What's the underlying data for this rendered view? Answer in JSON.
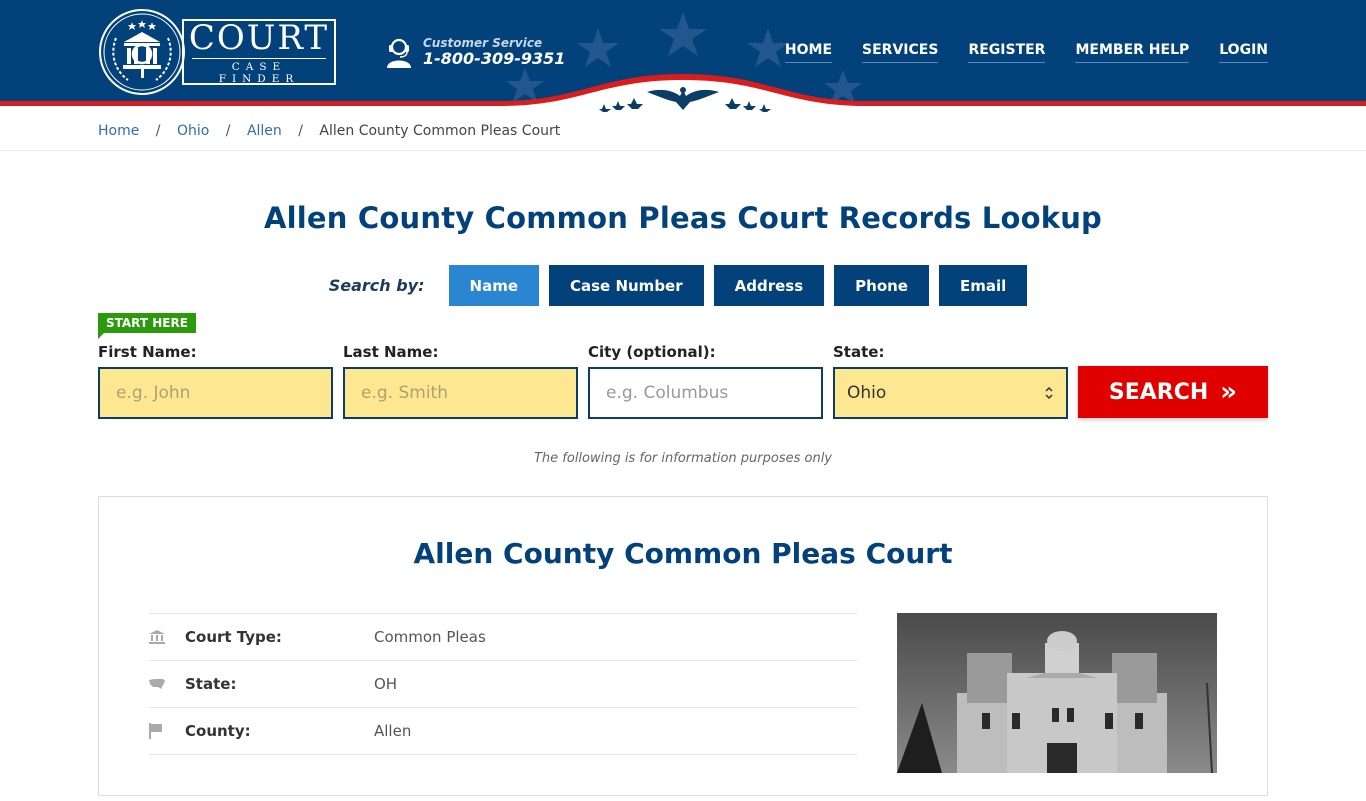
{
  "header": {
    "logo": {
      "title": "COURT",
      "subtitle": "CASE FINDER"
    },
    "customer_service": {
      "label": "Customer Service",
      "phone": "1-800-309-9351"
    },
    "nav": [
      {
        "label": "HOME"
      },
      {
        "label": "SERVICES"
      },
      {
        "label": "REGISTER"
      },
      {
        "label": "MEMBER HELP"
      },
      {
        "label": "LOGIN"
      }
    ]
  },
  "breadcrumb": {
    "items": [
      {
        "label": "Home"
      },
      {
        "label": "Ohio"
      },
      {
        "label": "Allen"
      }
    ],
    "current": "Allen County Common Pleas Court",
    "separator": "/"
  },
  "main": {
    "title": "Allen County Common Pleas Court Records Lookup",
    "search_by": {
      "label": "Search by:",
      "tabs": [
        {
          "label": "Name",
          "active": true
        },
        {
          "label": "Case Number",
          "active": false
        },
        {
          "label": "Address",
          "active": false
        },
        {
          "label": "Phone",
          "active": false
        },
        {
          "label": "Email",
          "active": false
        }
      ]
    },
    "form": {
      "badge": "START HERE",
      "first_name": {
        "label": "First Name:",
        "placeholder": "e.g. John",
        "value": ""
      },
      "last_name": {
        "label": "Last Name:",
        "placeholder": "e.g. Smith",
        "value": ""
      },
      "city": {
        "label": "City (optional):",
        "placeholder": "e.g.  Columbus",
        "value": ""
      },
      "state": {
        "label": "State:",
        "value": "Ohio"
      },
      "search_button": "SEARCH",
      "search_arrow": "»"
    },
    "disclaimer": "The following is for information purposes only"
  },
  "court": {
    "title": "Allen County Common Pleas Court",
    "details": [
      {
        "icon": "bank-icon",
        "label": "Court Type:",
        "value": "Common Pleas"
      },
      {
        "icon": "usa-map-icon",
        "label": "State:",
        "value": "OH"
      },
      {
        "icon": "flag-icon",
        "label": "County:",
        "value": "Allen"
      }
    ],
    "photo_alt": "Allen County Courthouse"
  },
  "colors": {
    "brand_navy": "#03417a",
    "active_tab": "#2a86d1",
    "search_red": "#e10000",
    "start_green": "#2b9a0d",
    "input_yellow": "#fde891"
  }
}
